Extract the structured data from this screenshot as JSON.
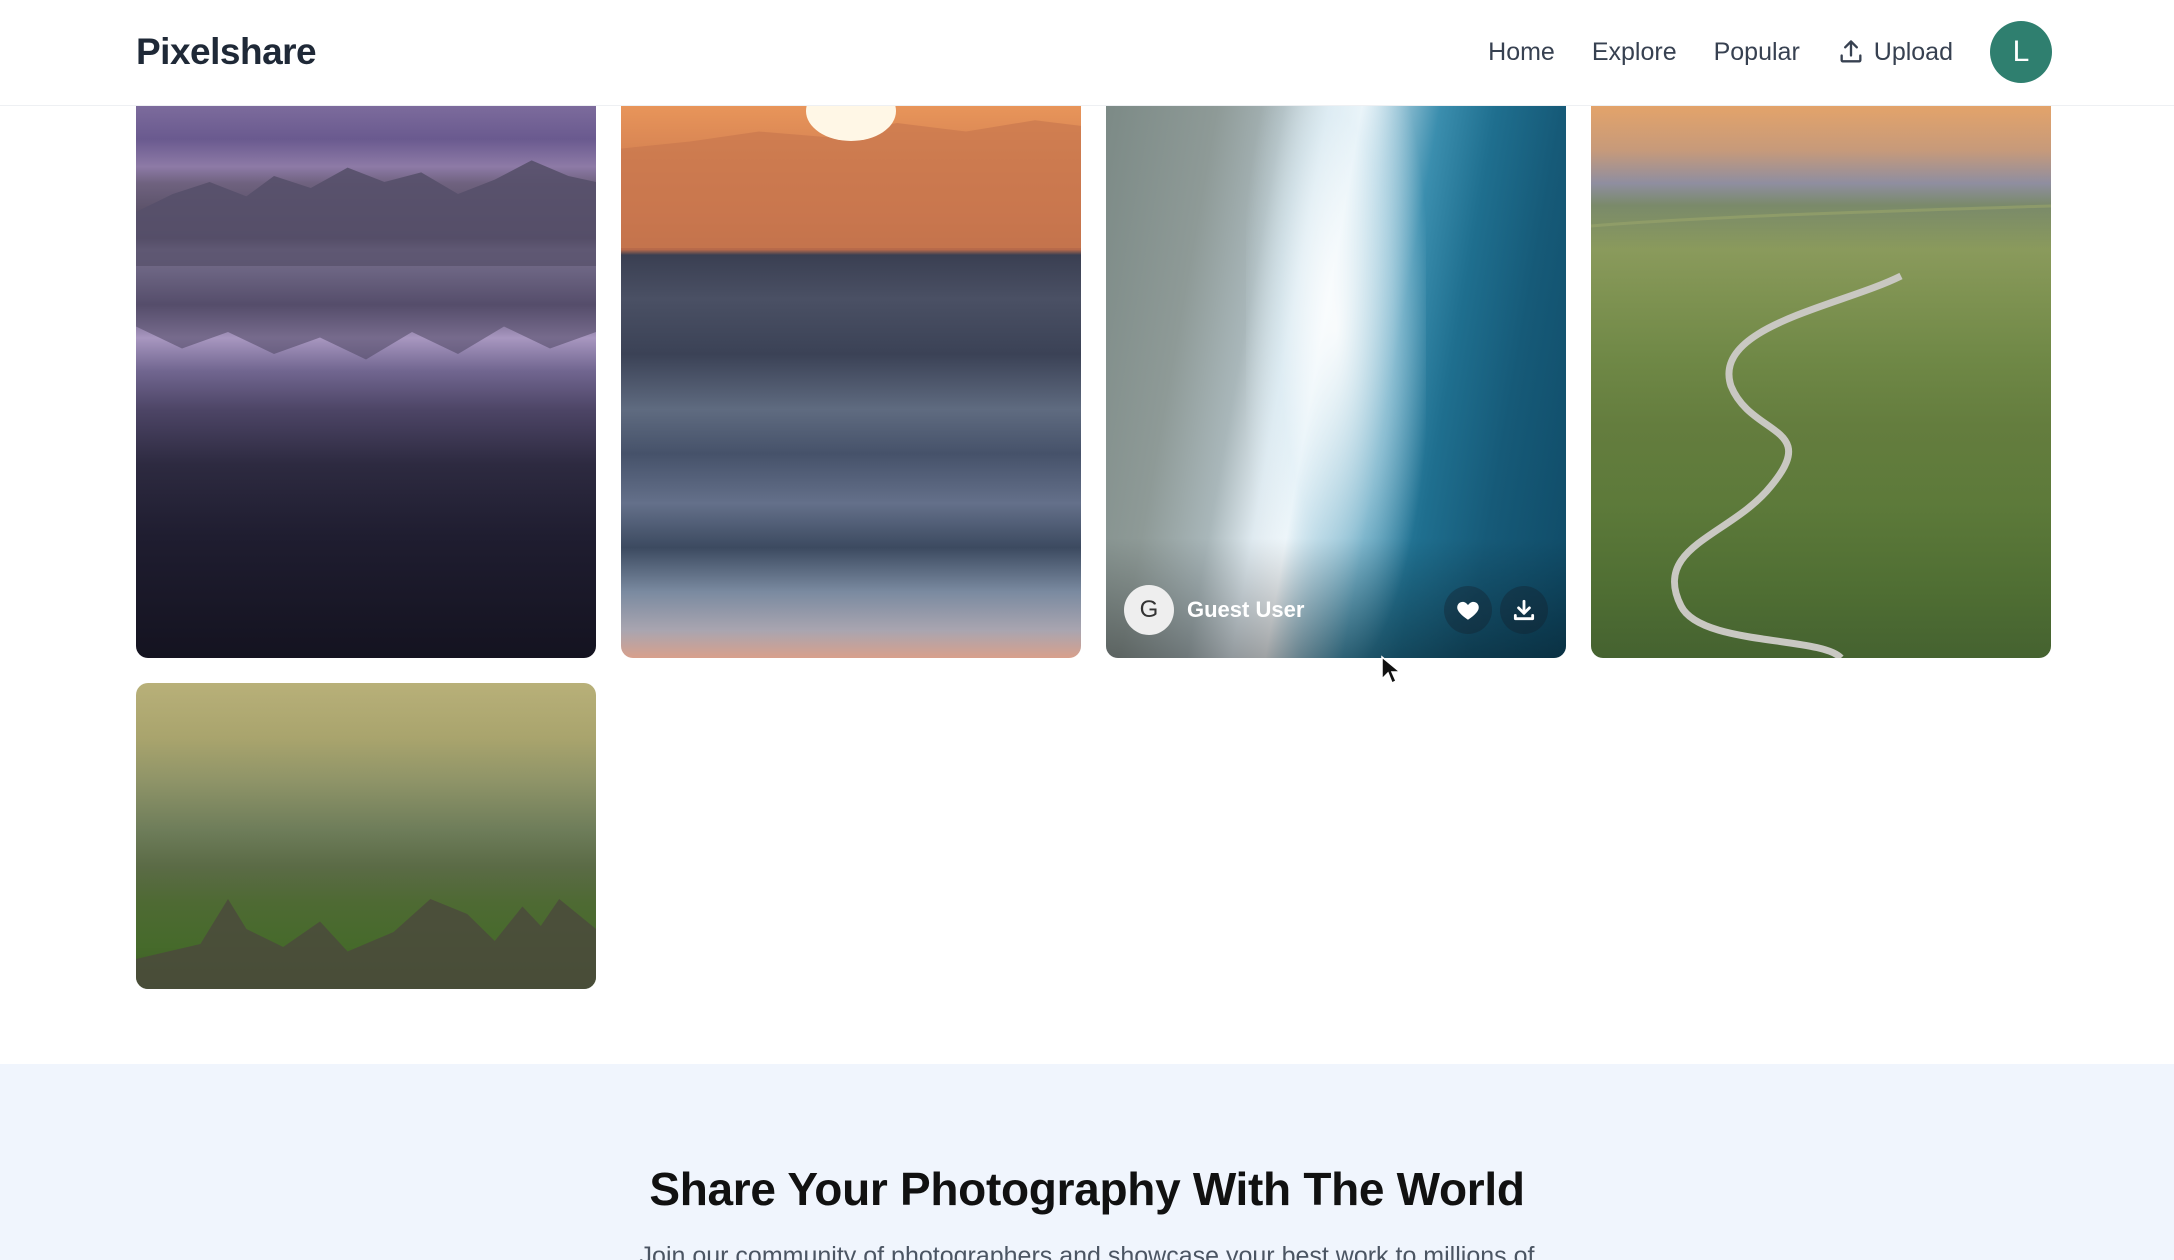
{
  "header": {
    "logo": "Pixelshare",
    "nav": [
      {
        "label": "Home"
      },
      {
        "label": "Explore"
      },
      {
        "label": "Popular"
      },
      {
        "label": "Upload",
        "icon": "upload-icon"
      }
    ],
    "avatar_initial": "L"
  },
  "gallery": {
    "hovered_photo": {
      "author_initial": "G",
      "author_name": "Guest User",
      "actions": [
        "heart-icon",
        "download-icon"
      ]
    }
  },
  "cta": {
    "title": "Share Your Photography With The World",
    "subtitle": "Join our community of photographers and showcase your best work to millions of"
  },
  "colors": {
    "avatar_bg": "#2f7f6f",
    "cta_bg": "#f0f5fd"
  }
}
